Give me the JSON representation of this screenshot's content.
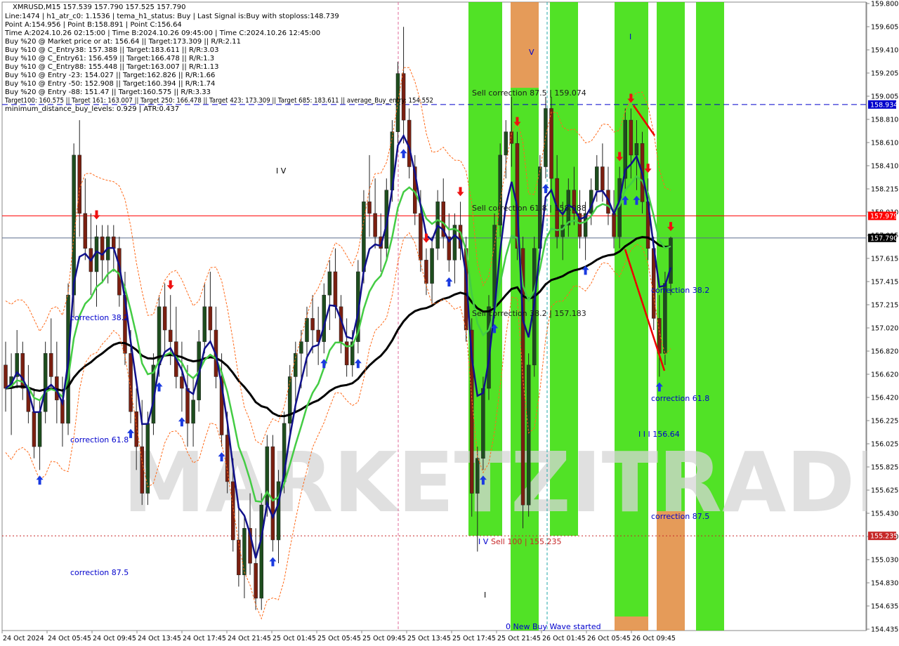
{
  "chart_data": {
    "type": "candlestick",
    "symbol_line": "XMRUSD,M15  157.539 157.790 157.525 157.790",
    "info_lines": [
      "Line:1474  |  h1_atr_c0: 1.1536  |  tema_h1_status: Buy  |  Last Signal is:Buy with stoploss:148.739",
      "Point A:154.956  |  Point B:158.891  |  Point C:156.64",
      "Time A:2024.10.26 02:15:00  |  Time B:2024.10.26 09:45:00  |  Time C:2024.10.26 12:45:00",
      "Buy %20 @ Market price or at: 156.64  ||  Target:173.309  ||  R/R:2.11",
      "Buy %10 @ C_Entry38: 157.388  ||  Target:183.611  ||  R/R:3.03",
      "Buy %10 @ C_Entry61: 156.459  ||  Target:166.478  ||  R/R:1.3",
      "Buy %10 @ C_Entry88: 155.448  ||  Target:163.007  ||  R/R:1.13",
      "Buy %10 @ Entry -23: 154.027  ||  Target:162.826  ||  R/R:1.66",
      "Buy %10 @ Entry -50: 152.908  ||  Target:160.394  ||  R/R:1.74",
      "Buy %20 @ Entry -88: 151.47  ||  Target:160.575  ||  R/R:3.33",
      "Target100: 160.575  ||  Target 161: 163.007  ||  Target 250: 166.478  ||  Target 423: 173.309  ||  Target 685: 183.611  ||  average_Buy_entry: 154.552",
      "minimum_distance_buy_levels: 0.929  |  ATR:0.437"
    ],
    "y_ticks": [
      "159.800",
      "159.605",
      "159.410",
      "159.205",
      "159.005",
      "158.810",
      "158.610",
      "158.410",
      "158.215",
      "158.010",
      "157.815",
      "157.615",
      "157.415",
      "157.215",
      "157.020",
      "156.820",
      "156.620",
      "156.420",
      "156.225",
      "156.025",
      "155.825",
      "155.625",
      "155.430",
      "155.230",
      "155.030",
      "154.830",
      "154.635",
      "154.435"
    ],
    "x_ticks": [
      "24 Oct 2024",
      "24 Oct 05:45",
      "24 Oct 09:45",
      "24 Oct 13:45",
      "24 Oct 17:45",
      "24 Oct 21:45",
      "25 Oct 01:45",
      "25 Oct 05:45",
      "25 Oct 09:45",
      "25 Oct 13:45",
      "25 Oct 17:45",
      "25 Oct 21:45",
      "26 Oct 01:45",
      "26 Oct 05:45",
      "26 Oct 09:45"
    ],
    "price_labels": [
      {
        "text": "158.934",
        "value": 158.934,
        "color": "#0000cc"
      },
      {
        "text": "157.979",
        "value": 157.979,
        "color": "#ff0000"
      },
      {
        "text": "157.790",
        "value": 157.79,
        "color": "#000000"
      },
      {
        "text": "155.235",
        "value": 155.235,
        "color": "#c62828"
      }
    ],
    "annotations": [
      {
        "text": "I V",
        "color": "#000000"
      },
      {
        "text": "V",
        "color": "#0000cc"
      },
      {
        "text": "I",
        "color": "#0000cc"
      },
      {
        "text": "I",
        "color": "#000000"
      },
      {
        "text": "I V",
        "color": "#0000cc"
      },
      {
        "text": "Sell correction 87.5 | 159.074",
        "color": "#1a1a1a"
      },
      {
        "text": "Sell correction 61.8 | 158.088",
        "color": "#1a1a1a"
      },
      {
        "text": "Sell correction 38.2 | 157.183",
        "color": "#1a1a1a"
      },
      {
        "text": "Sell 100 | 155.235",
        "color": "#c62828"
      },
      {
        "text": "correction 38.2",
        "color": "#0000cc"
      },
      {
        "text": "correction 61.8",
        "color": "#0000cc"
      },
      {
        "text": "correction 87.5",
        "color": "#0000cc"
      },
      {
        "text": "correction 38.2",
        "color": "#0000cc"
      },
      {
        "text": "correction 61.8",
        "color": "#0000cc"
      },
      {
        "text": "correction 87.5",
        "color": "#0000cc"
      },
      {
        "text": "I I I 156.64",
        "color": "#0000cc"
      },
      {
        "text": "0 New Buy Wave started",
        "color": "#0000cc"
      }
    ],
    "horizontal_levels": [
      {
        "value": 158.934,
        "style": "dashed",
        "color": "#0000cc"
      },
      {
        "value": 157.979,
        "style": "solid",
        "color": "#ff0000"
      },
      {
        "value": 157.79,
        "style": "solid",
        "color": "#5a6b8c"
      },
      {
        "value": 155.235,
        "style": "dotted",
        "color": "#c62828"
      }
    ],
    "watermark": "MARKETZITRADE",
    "ohlc": [
      [
        156.7,
        156.9,
        156.3,
        156.5
      ],
      [
        156.5,
        156.8,
        156.1,
        156.6
      ],
      [
        156.6,
        157.0,
        156.5,
        156.8
      ],
      [
        156.8,
        156.9,
        156.4,
        156.5
      ],
      [
        156.5,
        156.7,
        156.2,
        156.3
      ],
      [
        156.3,
        156.5,
        155.9,
        156.0
      ],
      [
        156.0,
        156.4,
        155.8,
        156.3
      ],
      [
        156.3,
        156.9,
        156.2,
        156.8
      ],
      [
        156.8,
        157.1,
        156.5,
        156.6
      ],
      [
        156.6,
        156.9,
        156.2,
        156.4
      ],
      [
        156.4,
        156.6,
        156.0,
        156.2
      ],
      [
        156.2,
        157.4,
        156.1,
        157.3
      ],
      [
        157.3,
        158.6,
        157.1,
        158.5
      ],
      [
        158.5,
        158.8,
        157.8,
        158.0
      ],
      [
        158.0,
        158.3,
        157.6,
        157.7
      ],
      [
        157.7,
        158.0,
        157.3,
        157.5
      ],
      [
        157.5,
        157.9,
        157.2,
        157.8
      ],
      [
        157.8,
        157.9,
        157.4,
        157.6
      ],
      [
        157.6,
        157.9,
        157.4,
        157.8
      ],
      [
        157.8,
        157.9,
        157.5,
        157.7
      ],
      [
        157.7,
        157.8,
        157.2,
        157.3
      ],
      [
        157.3,
        157.5,
        156.7,
        156.8
      ],
      [
        156.8,
        157.0,
        156.2,
        156.3
      ],
      [
        156.3,
        156.5,
        155.8,
        156.0
      ],
      [
        156.0,
        156.4,
        155.5,
        155.6
      ],
      [
        155.6,
        156.3,
        155.5,
        156.2
      ],
      [
        156.2,
        156.8,
        156.1,
        156.7
      ],
      [
        156.7,
        157.3,
        156.6,
        157.2
      ],
      [
        157.2,
        157.4,
        156.8,
        157.0
      ],
      [
        157.0,
        157.3,
        156.7,
        156.9
      ],
      [
        156.9,
        157.2,
        156.5,
        156.6
      ],
      [
        156.6,
        156.9,
        156.3,
        156.5
      ],
      [
        156.5,
        156.7,
        156.0,
        156.2
      ],
      [
        156.2,
        156.6,
        156.0,
        156.4
      ],
      [
        156.4,
        157.0,
        156.3,
        156.9
      ],
      [
        156.9,
        157.4,
        156.8,
        157.2
      ],
      [
        157.2,
        157.5,
        156.9,
        157.0
      ],
      [
        157.0,
        157.2,
        156.5,
        156.6
      ],
      [
        156.6,
        156.8,
        156.0,
        156.1
      ],
      [
        156.1,
        156.3,
        155.6,
        155.7
      ],
      [
        155.7,
        155.9,
        155.1,
        155.2
      ],
      [
        155.2,
        155.5,
        154.8,
        154.9
      ],
      [
        154.9,
        155.4,
        154.7,
        155.3
      ],
      [
        155.3,
        155.6,
        154.9,
        155.0
      ],
      [
        155.0,
        155.3,
        154.6,
        154.7
      ],
      [
        154.7,
        155.6,
        154.6,
        155.5
      ],
      [
        155.5,
        156.1,
        155.4,
        156.0
      ],
      [
        156.0,
        156.1,
        155.1,
        155.2
      ],
      [
        155.2,
        155.8,
        155.0,
        155.7
      ],
      [
        155.7,
        156.3,
        155.6,
        156.2
      ],
      [
        156.2,
        156.7,
        156.1,
        156.6
      ],
      [
        156.6,
        156.9,
        156.3,
        156.8
      ],
      [
        156.8,
        157.0,
        156.5,
        156.9
      ],
      [
        156.9,
        157.2,
        156.6,
        157.1
      ],
      [
        157.1,
        157.3,
        156.8,
        157.0
      ],
      [
        157.0,
        157.2,
        156.7,
        156.9
      ],
      [
        156.9,
        157.4,
        156.8,
        157.3
      ],
      [
        157.3,
        157.6,
        157.0,
        157.5
      ],
      [
        157.5,
        157.7,
        157.1,
        157.2
      ],
      [
        157.2,
        157.3,
        156.8,
        156.9
      ],
      [
        156.9,
        157.1,
        156.6,
        156.7
      ],
      [
        156.7,
        157.0,
        156.6,
        156.9
      ],
      [
        156.9,
        157.6,
        156.8,
        157.5
      ],
      [
        157.5,
        158.2,
        157.4,
        158.1
      ],
      [
        158.1,
        158.5,
        157.8,
        158.0
      ],
      [
        158.0,
        158.3,
        157.7,
        157.8
      ],
      [
        157.8,
        158.0,
        157.5,
        157.7
      ],
      [
        157.7,
        158.3,
        157.6,
        158.2
      ],
      [
        158.2,
        158.8,
        158.1,
        158.7
      ],
      [
        158.7,
        159.3,
        158.6,
        159.2
      ],
      [
        159.2,
        159.6,
        158.6,
        158.8
      ],
      [
        158.8,
        158.9,
        158.3,
        158.4
      ],
      [
        158.4,
        158.5,
        157.9,
        158.0
      ],
      [
        158.0,
        158.2,
        157.5,
        157.6
      ],
      [
        157.6,
        157.7,
        157.3,
        157.4
      ],
      [
        157.4,
        157.8,
        157.2,
        157.7
      ],
      [
        157.7,
        158.2,
        157.6,
        158.1
      ],
      [
        158.1,
        158.3,
        157.7,
        157.8
      ],
      [
        157.8,
        158.0,
        157.5,
        157.6
      ],
      [
        157.6,
        158.0,
        157.4,
        157.9
      ],
      [
        157.9,
        158.1,
        157.6,
        157.7
      ],
      [
        157.7,
        157.8,
        156.9,
        157.0
      ],
      [
        157.0,
        157.1,
        155.4,
        155.6
      ],
      [
        155.6,
        156.0,
        155.1,
        155.9
      ],
      [
        155.9,
        156.6,
        155.8,
        156.5
      ],
      [
        156.5,
        157.3,
        156.4,
        157.2
      ],
      [
        157.2,
        158.0,
        157.1,
        157.9
      ],
      [
        157.9,
        158.6,
        157.8,
        158.5
      ],
      [
        158.5,
        158.8,
        158.3,
        158.7
      ],
      [
        158.7,
        159.0,
        158.4,
        158.6
      ],
      [
        158.6,
        158.7,
        157.6,
        157.7
      ],
      [
        157.7,
        157.8,
        155.3,
        155.5
      ],
      [
        155.5,
        156.8,
        155.4,
        156.7
      ],
      [
        156.7,
        157.8,
        156.6,
        157.7
      ],
      [
        157.7,
        158.5,
        157.6,
        158.4
      ],
      [
        158.4,
        159.0,
        158.3,
        158.9
      ],
      [
        158.9,
        159.0,
        158.2,
        158.3
      ],
      [
        158.3,
        158.5,
        157.7,
        157.8
      ],
      [
        157.8,
        158.1,
        157.6,
        157.9
      ],
      [
        157.9,
        158.3,
        157.8,
        158.2
      ],
      [
        158.2,
        158.4,
        157.9,
        158.0
      ],
      [
        158.0,
        158.2,
        157.7,
        157.8
      ],
      [
        157.8,
        158.1,
        157.6,
        158.0
      ],
      [
        158.0,
        158.3,
        157.9,
        158.2
      ],
      [
        158.2,
        158.5,
        158.1,
        158.4
      ],
      [
        158.4,
        158.6,
        158.1,
        158.2
      ],
      [
        158.2,
        158.4,
        157.9,
        158.0
      ],
      [
        158.0,
        158.2,
        157.7,
        157.8
      ],
      [
        157.8,
        158.4,
        157.7,
        158.3
      ],
      [
        158.3,
        158.9,
        158.2,
        158.8
      ],
      [
        158.8,
        158.9,
        158.3,
        158.5
      ],
      [
        158.5,
        158.8,
        158.2,
        158.6
      ],
      [
        158.6,
        158.7,
        158.0,
        158.1
      ],
      [
        158.1,
        158.3,
        157.6,
        157.7
      ],
      [
        157.7,
        157.8,
        157.0,
        157.1
      ],
      [
        157.1,
        157.3,
        156.6,
        156.8
      ],
      [
        156.8,
        157.5,
        156.7,
        157.4
      ],
      [
        157.4,
        157.8,
        157.3,
        157.79
      ]
    ]
  }
}
